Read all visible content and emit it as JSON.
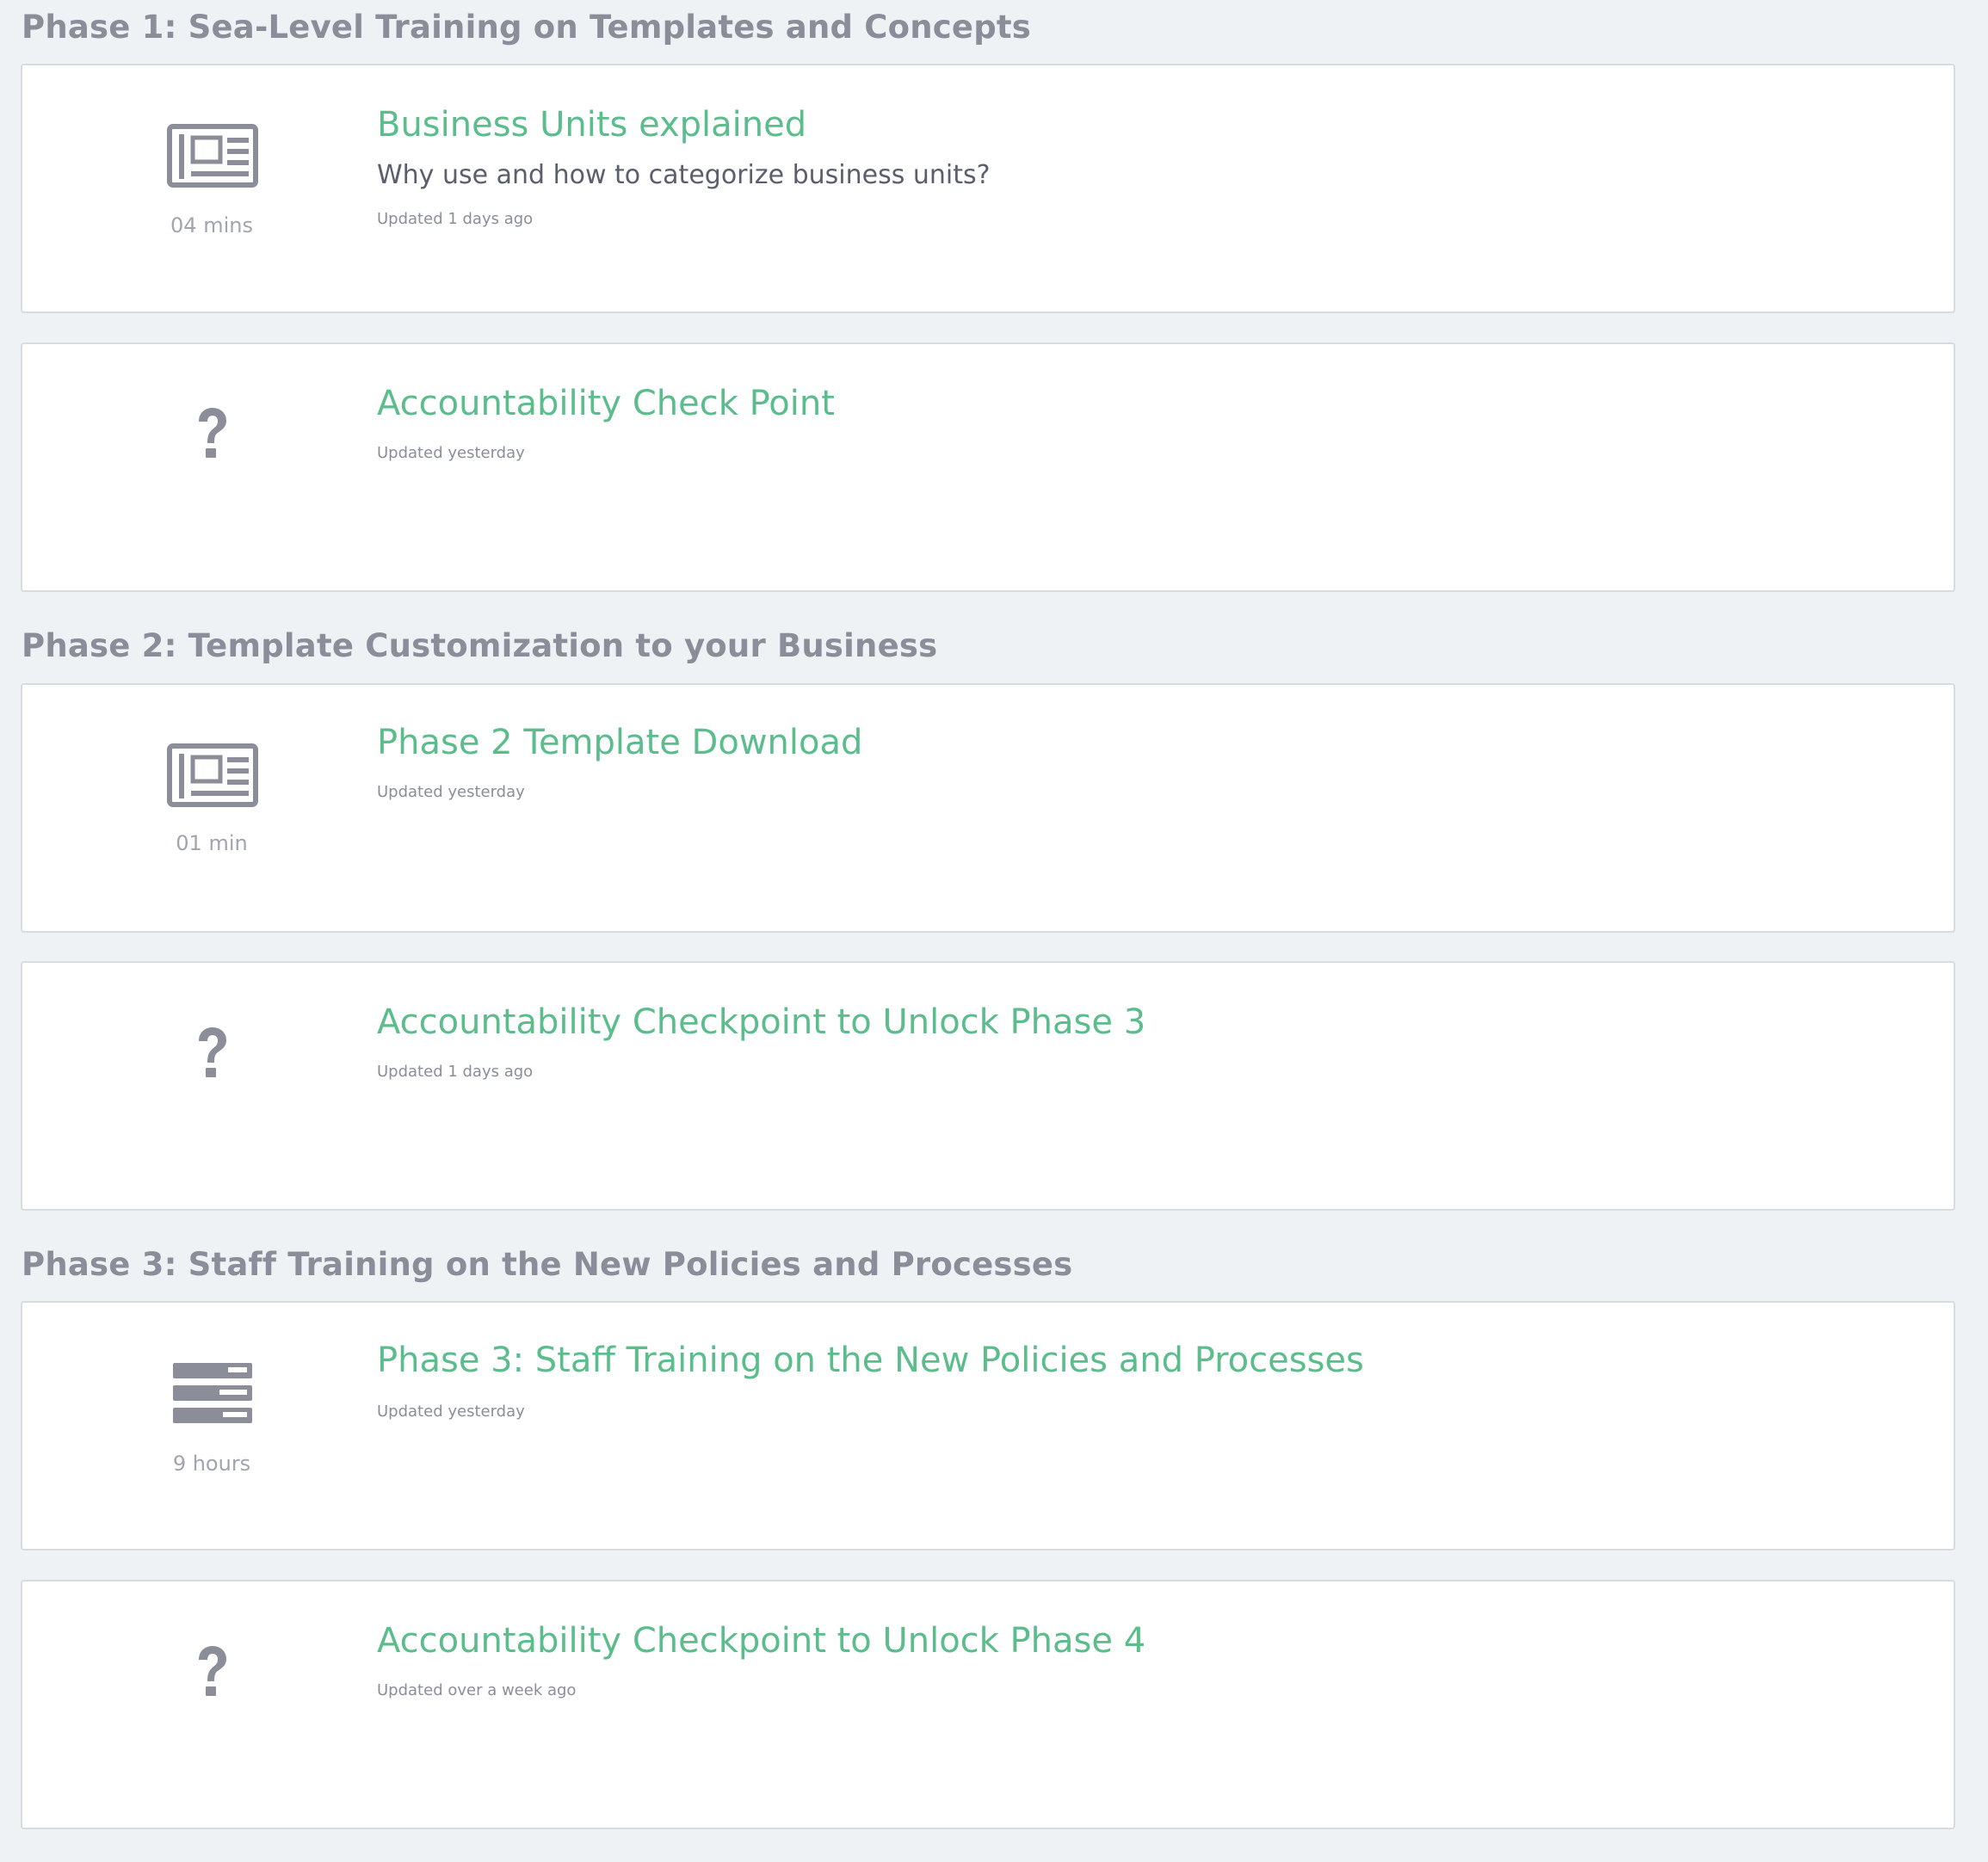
{
  "sections": [
    {
      "title": "Phase 1: Sea-Level Training on Templates and Concepts",
      "items": [
        {
          "icon": "newspaper-icon",
          "duration": "04 mins",
          "title": "Business Units explained",
          "description": "Why use and how to categorize business units?",
          "updated": "Updated 1 days ago"
        },
        {
          "icon": "question-icon",
          "title": "Accountability Check Point",
          "updated": "Updated yesterday"
        }
      ]
    },
    {
      "title": "Phase 2: Template Customization to your Business",
      "items": [
        {
          "icon": "newspaper-icon",
          "duration": "01 min",
          "title": "Phase 2 Template Download",
          "updated": "Updated yesterday"
        },
        {
          "icon": "question-icon",
          "title": "Accountability Checkpoint to Unlock Phase 3",
          "updated": "Updated 1 days ago"
        }
      ]
    },
    {
      "title": "Phase 3: Staff Training on the New Policies and Processes",
      "items": [
        {
          "icon": "course-stack-icon",
          "duration": "9 hours",
          "title": "Phase 3: Staff Training on the New Policies and Processes",
          "updated": "Updated yesterday"
        },
        {
          "icon": "question-icon",
          "title": "Accountability Checkpoint to Unlock Phase 4",
          "updated": "Updated over a week ago"
        }
      ]
    }
  ],
  "colors": {
    "background": "#eff2f5",
    "card": "#ffffff",
    "border": "#d7dce1",
    "heading": "#8b8d99",
    "accent": "#5bbd8b",
    "description": "#5b5e6c",
    "muted": "#a2a4ae"
  }
}
